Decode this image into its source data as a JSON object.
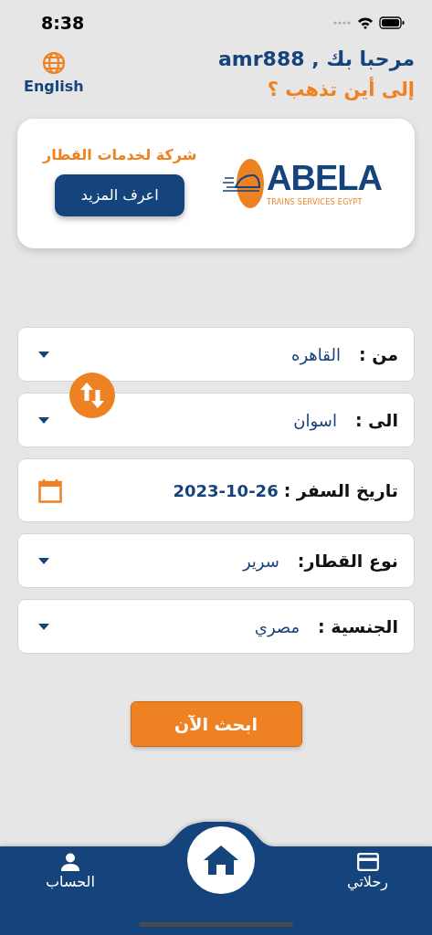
{
  "status_bar": {
    "time": "8:38"
  },
  "header": {
    "greeting": "مرحبا بك , amr888",
    "subtitle": "إلى أين تذهب ؟",
    "language_button": "English"
  },
  "promo_card": {
    "title": "شركة لخدمات القطار",
    "button": "اعرف المزيد",
    "logo_text": "ABELA",
    "logo_tagline": "TRAINS SERVICES EGYPT"
  },
  "fields": [
    {
      "kind": "dropdown",
      "label": "من :",
      "value": "القاهره"
    },
    {
      "kind": "dropdown",
      "label": "الى :",
      "value": "اسوان"
    },
    {
      "kind": "date",
      "label": "تاريخ السفر :",
      "value": "2023-10-26"
    },
    {
      "kind": "dropdown",
      "label": "نوع القطار:",
      "value": "سرير"
    },
    {
      "kind": "dropdown",
      "label": "الجنسية :",
      "value": "مصري"
    }
  ],
  "search_button": "ابحث الآن",
  "bottom_nav": {
    "items": [
      {
        "kind": "trips",
        "label": "رحلاتي"
      },
      {
        "kind": "home"
      },
      {
        "kind": "account",
        "label": "الحساب"
      }
    ]
  }
}
